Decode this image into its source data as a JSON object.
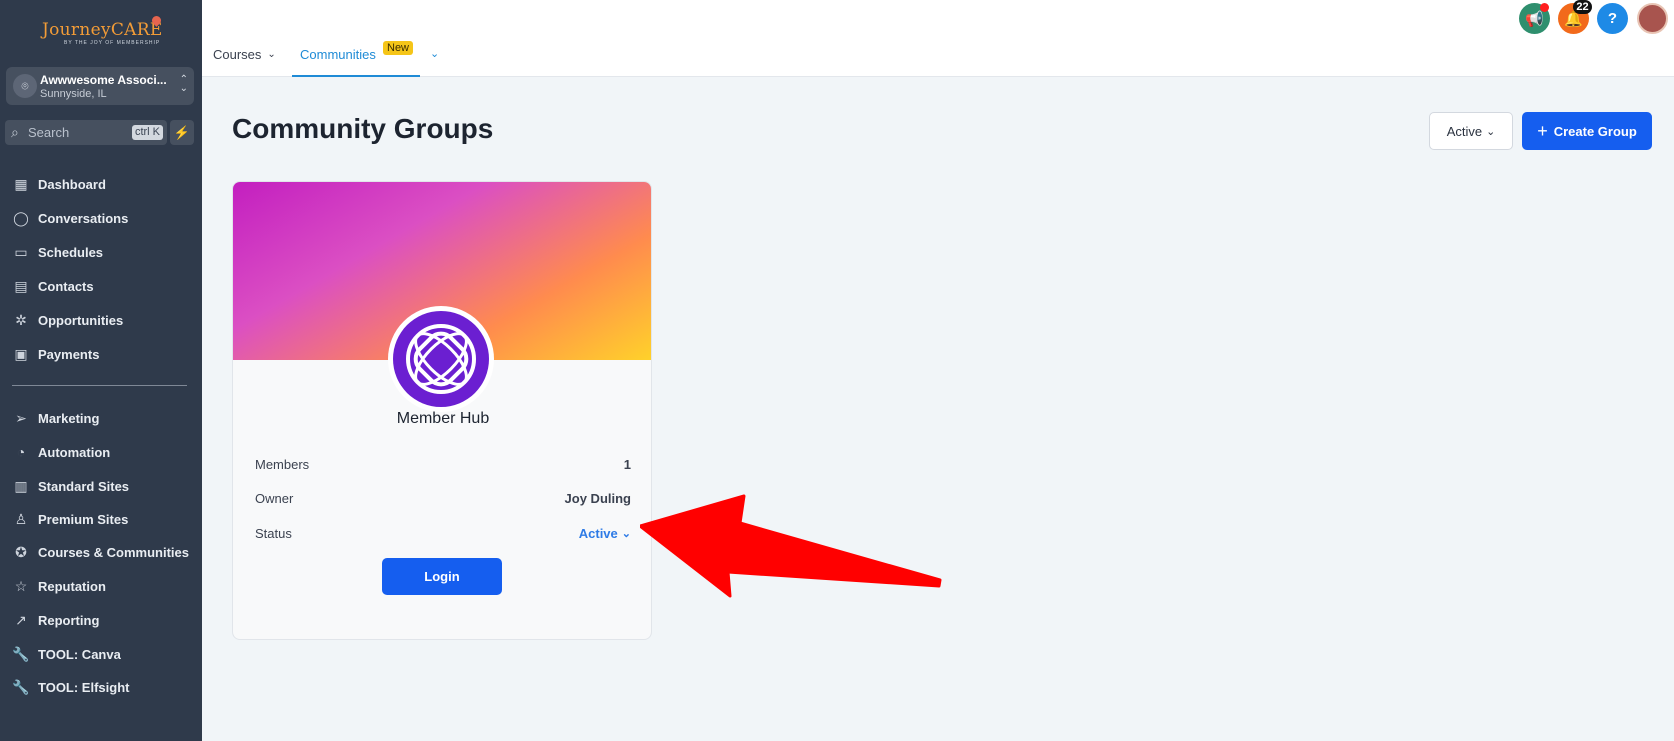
{
  "brand": {
    "logo_text": "JourneyCARE",
    "tagline": "BY THE JOY OF MEMBERSHIP"
  },
  "account": {
    "name": "Awwwesome Associ...",
    "location": "Sunnyside, IL"
  },
  "search": {
    "placeholder": "Search",
    "shortcut": "ctrl K"
  },
  "sidebar": {
    "items": [
      {
        "label": "Dashboard",
        "icon": "dashboard-icon"
      },
      {
        "label": "Conversations",
        "icon": "chat-icon"
      },
      {
        "label": "Schedules",
        "icon": "calendar-icon"
      },
      {
        "label": "Contacts",
        "icon": "contacts-icon"
      },
      {
        "label": "Opportunities",
        "icon": "opportunities-icon"
      },
      {
        "label": "Payments",
        "icon": "payments-icon"
      },
      {
        "label": "Marketing",
        "icon": "send-icon"
      },
      {
        "label": "Automation",
        "icon": "automation-icon"
      },
      {
        "label": "Standard Sites",
        "icon": "sites-icon"
      },
      {
        "label": "Premium Sites",
        "icon": "premium-icon"
      },
      {
        "label": "Courses & Communities",
        "icon": "award-icon"
      },
      {
        "label": "Reputation",
        "icon": "star-icon"
      },
      {
        "label": "Reporting",
        "icon": "trend-icon"
      },
      {
        "label": "TOOL: Canva",
        "icon": "wrench-icon"
      },
      {
        "label": "TOOL: Elfsight",
        "icon": "wrench-icon"
      }
    ]
  },
  "topnav": {
    "tabs": [
      {
        "label": "Courses"
      },
      {
        "label": "Communities",
        "badge": "New",
        "active": true
      }
    ],
    "notification_count": "22",
    "help_label": "?"
  },
  "main": {
    "title": "Community Groups",
    "filter_label": "Active",
    "create_label": "Create Group"
  },
  "card": {
    "name": "Member Hub",
    "members_label": "Members",
    "members_value": "1",
    "owner_label": "Owner",
    "owner_value": "Joy Duling",
    "status_label": "Status",
    "status_value": "Active",
    "login_label": "Login"
  },
  "colors": {
    "sidebar_bg": "#2f3a4b",
    "primary": "#155eef",
    "active_tab": "#1f8bd6",
    "badge": "#f5c518",
    "annotation_arrow": "#ff0000"
  }
}
